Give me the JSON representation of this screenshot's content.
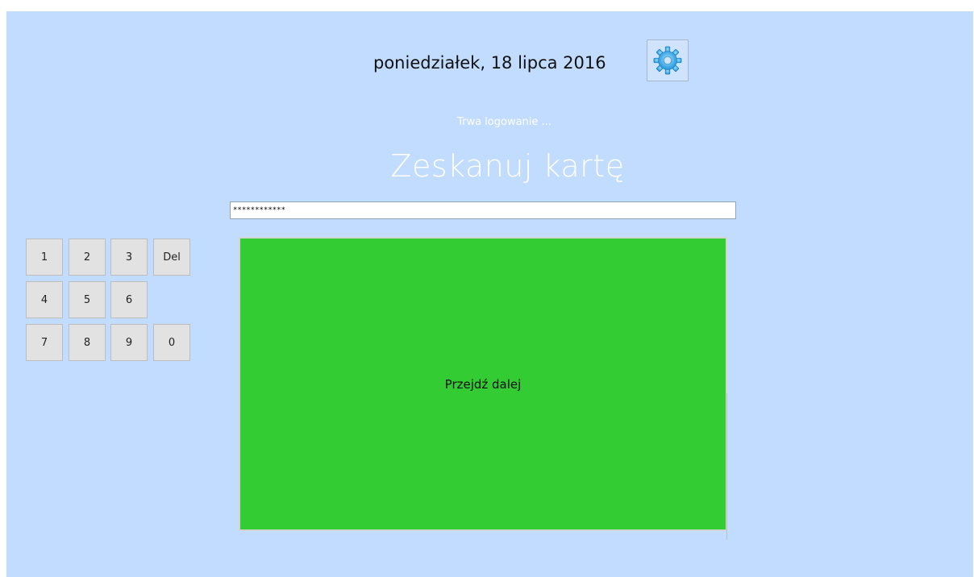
{
  "header": {
    "date": "poniedziałek, 18 lipca 2016",
    "settings_icon": "gear-icon",
    "gear_color": "#2aa3e8"
  },
  "login": {
    "status": "Trwa logowanie ...",
    "title": "Zeskanuj kartę",
    "pin_value": "************"
  },
  "keypad": {
    "k1": "1",
    "k2": "2",
    "k3": "3",
    "del": "Del",
    "k4": "4",
    "k5": "5",
    "k6": "6",
    "k7": "7",
    "k8": "8",
    "k9": "9",
    "k0": "0"
  },
  "action": {
    "proceed_label": "Przejdź dalej",
    "proceed_color": "#33cd33"
  }
}
